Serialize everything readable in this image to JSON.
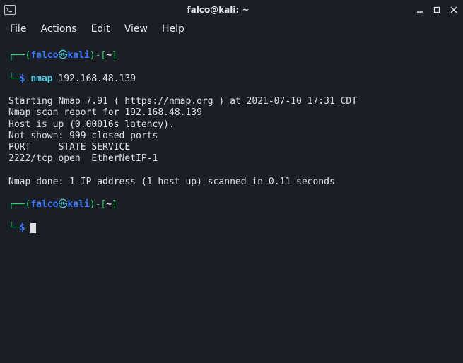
{
  "window": {
    "title": "falco@kali: ~"
  },
  "menu": {
    "file": "File",
    "actions": "Actions",
    "edit": "Edit",
    "view": "View",
    "help": "Help"
  },
  "prompt1": {
    "lparen": "(",
    "user": "falco",
    "at": "㉿",
    "host": "kali",
    "rparen": ")-[",
    "cwd": "~",
    "rbracket": "]",
    "sigil": "$",
    "command": "nmap",
    "arg": " 192.168.48.139"
  },
  "output": {
    "l1": "Starting Nmap 7.91 ( https://nmap.org ) at 2021-07-10 17:31 CDT",
    "l2": "Nmap scan report for 192.168.48.139",
    "l3": "Host is up (0.00016s latency).",
    "l4": "Not shown: 999 closed ports",
    "l5": "PORT     STATE SERVICE",
    "l6": "2222/tcp open  EtherNetIP-1",
    "l7": "",
    "l8": "Nmap done: 1 IP address (1 host up) scanned in 0.11 seconds"
  },
  "prompt2": {
    "lparen": "(",
    "user": "falco",
    "at": "㉿",
    "host": "kali",
    "rparen": ")-[",
    "cwd": "~",
    "rbracket": "]",
    "sigil": "$"
  }
}
